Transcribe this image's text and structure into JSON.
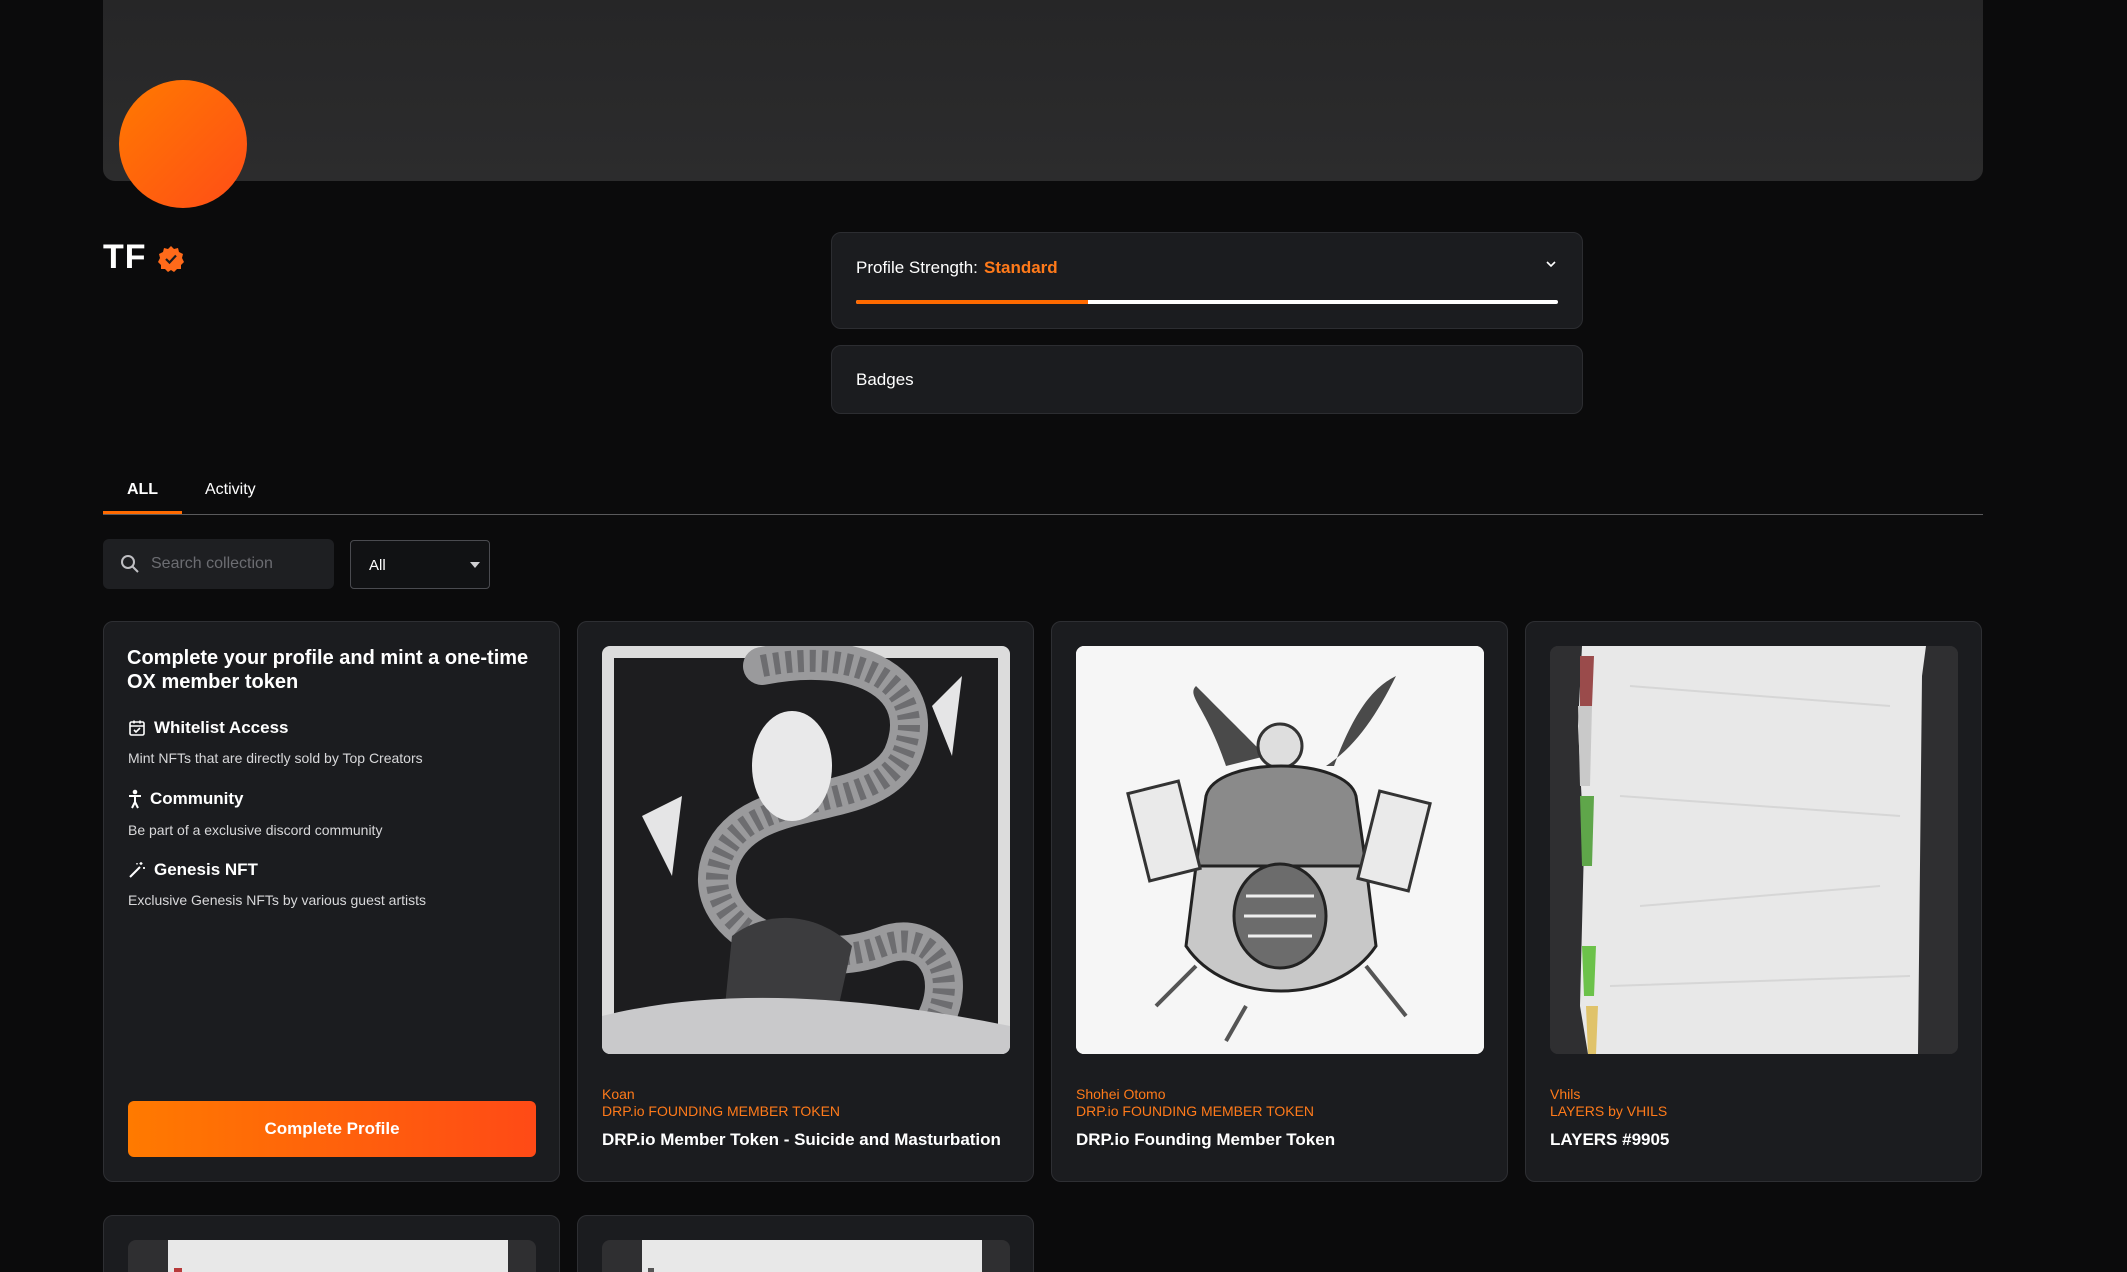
{
  "profile": {
    "name": "TF",
    "strength_label": "Profile Strength:",
    "strength_level": "Standard",
    "strength_progress": 0.33,
    "badges_label": "Badges"
  },
  "tabs": [
    {
      "label": "ALL",
      "active": true
    },
    {
      "label": "Activity",
      "active": false
    }
  ],
  "filters": {
    "search_placeholder": "Search collection",
    "select_value": "All"
  },
  "promo": {
    "heading": "Complete your profile and mint a one-time OX member token",
    "perks": [
      {
        "icon": "calendar-check-icon",
        "title": "Whitelist Access",
        "desc": "Mint NFTs that are directly sold by Top Creators"
      },
      {
        "icon": "person-icon",
        "title": "Community",
        "desc": "Be part of a exclusive discord community"
      },
      {
        "icon": "magic-wand-icon",
        "title": "Genesis NFT",
        "desc": "Exclusive Genesis NFTs by various guest artists"
      }
    ],
    "cta_label": "Complete Profile"
  },
  "nfts": [
    {
      "creator": "Koan",
      "collection": "DRP.io FOUNDING MEMBER TOKEN",
      "title": "DRP.io Member Token - Suicide and Masturbation"
    },
    {
      "creator": "Shohei Otomo",
      "collection": "DRP.io FOUNDING MEMBER TOKEN",
      "title": "DRP.io Founding Member Token"
    },
    {
      "creator": "Vhils",
      "collection": "LAYERS by VHILS",
      "title": "LAYERS #9905"
    }
  ],
  "colors": {
    "accent": "#ff6a00",
    "background": "#0b0b0c",
    "panel": "#1b1c1f"
  }
}
